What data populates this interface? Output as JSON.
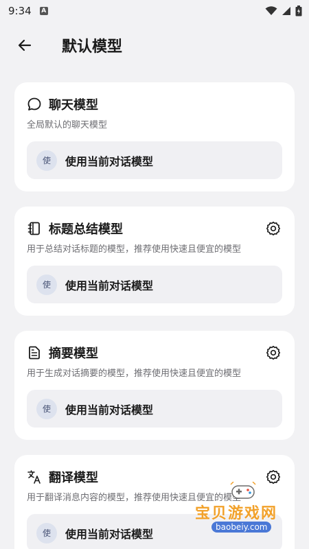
{
  "status_bar": {
    "time": "9:34",
    "notification_letter": "A"
  },
  "header": {
    "title": "默认模型"
  },
  "cards": [
    {
      "title": "聊天模型",
      "icon": "chat-bubble-icon",
      "description": "全局默认的聊天模型",
      "has_settings": false,
      "badge": "使",
      "model_label": "使用当前对话模型"
    },
    {
      "title": "标题总结模型",
      "icon": "notebook-icon",
      "description": "用于总结对话标题的模型，推荐使用快速且便宜的模型",
      "has_settings": true,
      "badge": "使",
      "model_label": "使用当前对话模型"
    },
    {
      "title": "摘要模型",
      "icon": "document-icon",
      "description": "用于生成对话摘要的模型，推荐使用快速且便宜的模型",
      "has_settings": true,
      "badge": "使",
      "model_label": "使用当前对话模型"
    },
    {
      "title": "翻译模型",
      "icon": "translate-icon",
      "description": "用于翻译消息内容的模型，推荐使用快速且便宜的模型",
      "has_settings": true,
      "badge": "使",
      "model_label": "使用当前对话模型"
    }
  ],
  "watermark": {
    "text": "宝贝游戏网",
    "url": "baobeiy.com"
  },
  "colors": {
    "background": "#f2f2f4",
    "card": "#ffffff",
    "select_bg": "#f0f0f3",
    "badge_bg": "#dde2ee",
    "watermark": "#f2a12a"
  }
}
